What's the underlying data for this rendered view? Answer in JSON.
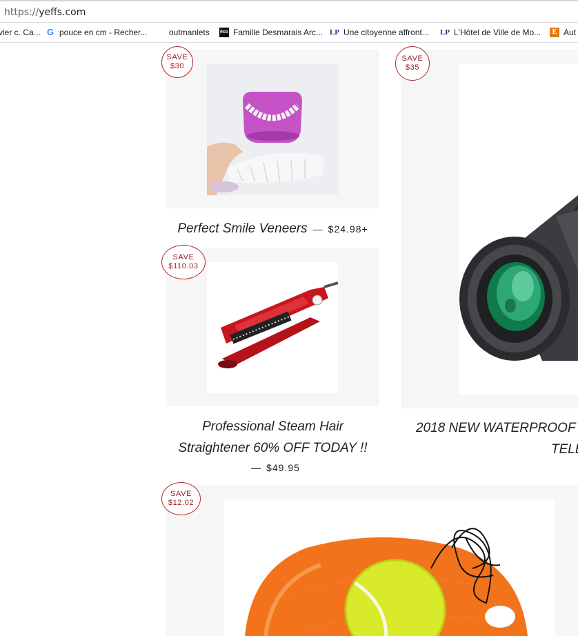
{
  "browser": {
    "url_scheme": "https://",
    "url_host": "yeffs.com"
  },
  "bookmarks": [
    {
      "label": "vier c. Ca...",
      "icon": "none"
    },
    {
      "label": "pouce en cm - Recher...",
      "icon": "google-icon"
    },
    {
      "label": "outmanlets",
      "icon": "none"
    },
    {
      "label": "Famille Desmarais Arc...",
      "icon": "eco-icon",
      "icon_text": "éco"
    },
    {
      "label": "Une citoyenne affront...",
      "icon": "lp-icon",
      "icon_text": "LP"
    },
    {
      "label": "L'Hôtel de Ville de Mo...",
      "icon": "lp-icon",
      "icon_text": "LP"
    },
    {
      "label": "Aut",
      "icon": "e-icon",
      "icon_text": "E"
    }
  ],
  "products": [
    {
      "save_word": "SAVE",
      "save_amount": "$30",
      "title": "Perfect Smile Veneers",
      "dash": "—",
      "price": "$24.98+",
      "image": "veneers-photo"
    },
    {
      "save_word": "SAVE",
      "save_amount": "$110.03",
      "title_line1": "Professional Steam Hair",
      "title_line2": "Straightener 60% OFF TODAY !!",
      "dash": "—",
      "price": "$49.95",
      "image": "hair-straightener-photo"
    },
    {
      "save_word": "SAVE",
      "save_amount": "$35",
      "title_line1": "2018 NEW WATERPROOF",
      "title_line2": "TELE",
      "image": "monocular-telescope-photo"
    },
    {
      "save_word": "SAVE",
      "save_amount": "$12.02",
      "image": "tennis-trainer-photo"
    }
  ]
}
